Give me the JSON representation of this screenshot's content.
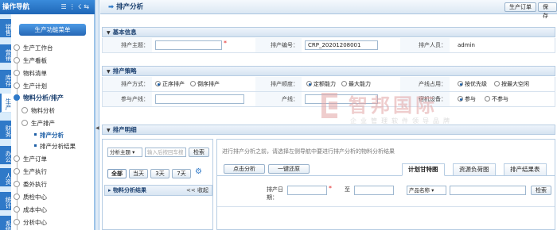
{
  "nav": {
    "title": "操作导航",
    "menu_button": "生产功能菜单",
    "items": [
      "生产工作台",
      "生产看板",
      "物料清单",
      "生产计划",
      "物料分析/排产",
      "物料分析",
      "生产排产",
      "排产分析",
      "排产分析结果",
      "生产订单",
      "生产执行",
      "委外执行",
      "质检中心",
      "成本中心",
      "分析中心"
    ],
    "vtabs": [
      "销售",
      "营销",
      "库存",
      "生产",
      "财务",
      "办公",
      "人资",
      "统计",
      "系统"
    ]
  },
  "header": {
    "title": "排产分析",
    "buttons": [
      "生产订单",
      "保存"
    ]
  },
  "basic": {
    "section": "基本信息",
    "name_label": "排产主题：",
    "name_value": "",
    "code_label": "排产编号：",
    "code_value": "CRP_20201208001",
    "person_label": "排产人员：",
    "person_value": "admin"
  },
  "strategy": {
    "section": "排产策略",
    "mode_label": "排产方式：",
    "mode_options": [
      "正序排产",
      "倒序排产"
    ],
    "mode_selected": 0,
    "priority_label": "排产顺度：",
    "priority_options": [
      "定额能力",
      "最大能力"
    ],
    "priority_selected": 0,
    "line_label": "产线占用：",
    "line_options": [
      "按优先级",
      "按最大空闲"
    ],
    "line_selected": 0,
    "line_join_label": "参与产线：",
    "cap_label": "产线：",
    "device_label": "宿机设备：",
    "device_options": [
      "参与",
      "不参与"
    ],
    "device_selected": 0
  },
  "detail": {
    "section": "排产明细",
    "select_value": "分析主题",
    "search_placeholder": "输入后按回车搜",
    "search_button": "检索",
    "quick": [
      "全部",
      "当天",
      "3天",
      "7天"
    ],
    "material_title": "物料分析结果",
    "collapse": "收起",
    "tip": "进行排产分析之前，请选择左侧导航中要进行排产分析的物料分析结果",
    "actions": [
      "点击分析",
      "一键还原"
    ],
    "tabs": [
      "计划甘特图",
      "资源负荷图",
      "排产结果表"
    ],
    "date_label": "排产日期：",
    "to_label": "至",
    "product_select": "产品名称",
    "search": "检索"
  },
  "watermark": {
    "big": "智邦国际",
    "small": "企业管理软件领导品牌"
  }
}
